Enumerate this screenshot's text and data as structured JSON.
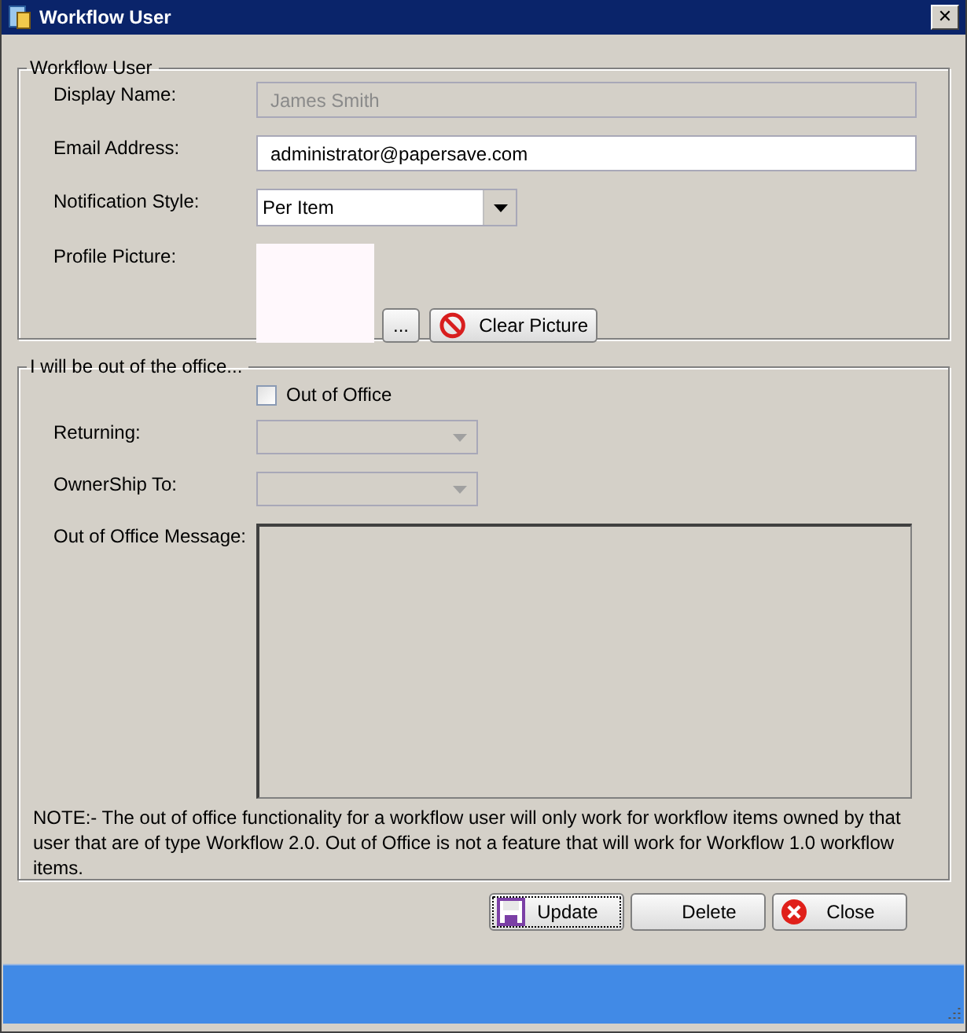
{
  "window": {
    "title": "Workflow User",
    "close_glyph": "✕"
  },
  "user_group": {
    "title": "Workflow User",
    "display_name": {
      "label": "Display Name:",
      "value": "James Smith",
      "disabled": true
    },
    "email": {
      "label": "Email Address:",
      "value": "administrator@papersave.com",
      "disabled": false
    },
    "notification_style": {
      "label": "Notification Style:",
      "value": "Per Item"
    },
    "profile_picture": {
      "label": "Profile Picture:",
      "browse_button": "...",
      "clear_button": "Clear Picture"
    }
  },
  "office_group": {
    "title": "I will be out of the office...",
    "out_of_office": {
      "label": "Out of Office",
      "checked": false
    },
    "returning": {
      "label": "Returning:",
      "disabled": true
    },
    "ownership_to": {
      "label": "OwnerShip To:",
      "disabled": true
    },
    "message": {
      "label": "Out of Office Message:",
      "disabled": true
    },
    "note": "NOTE:- The out of office functionality for a workflow user will only work for workflow items owned by that user that are of type Workflow 2.0.  Out of Office is not a feature that will work for Workflow 1.0 workflow items."
  },
  "buttons": [
    {
      "label": "Update",
      "kind": "save",
      "focused": true
    },
    {
      "label": "Delete",
      "kind": "plain",
      "focused": false
    },
    {
      "label": "Close",
      "kind": "close",
      "focused": false
    }
  ]
}
